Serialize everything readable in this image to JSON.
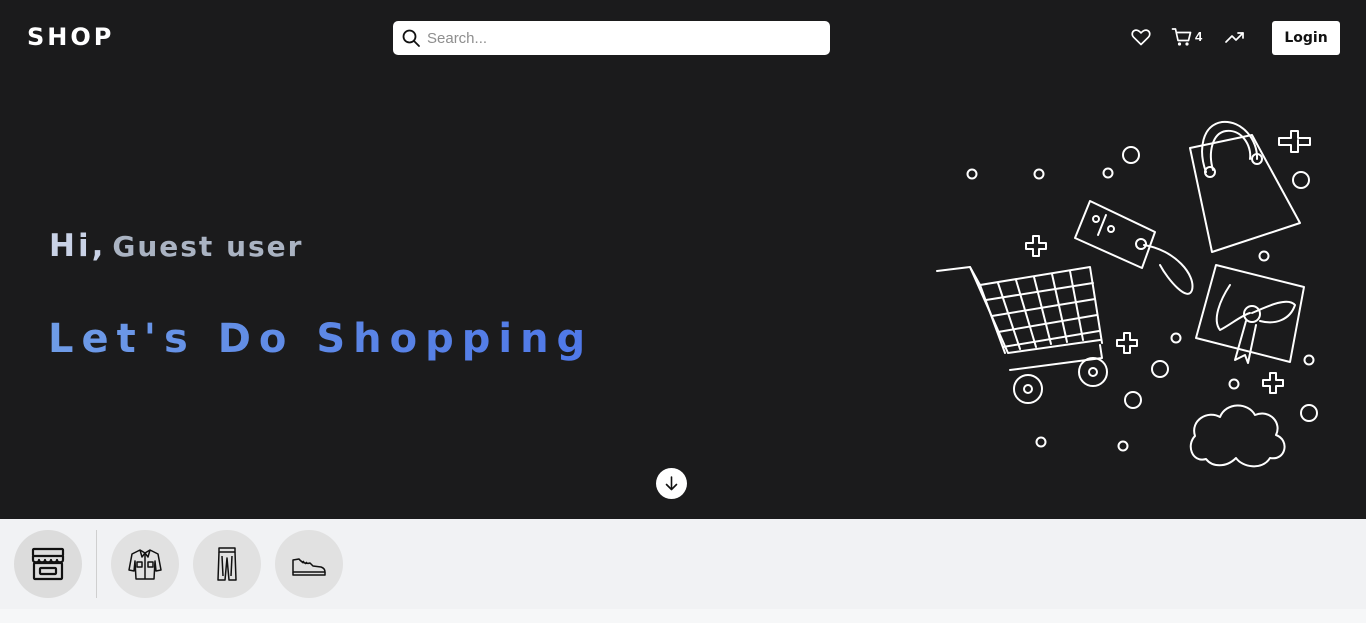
{
  "brand": {
    "logo_text": "SHOP"
  },
  "search": {
    "placeholder": "Search...",
    "value": ""
  },
  "header": {
    "icons": [
      "heart-icon",
      "cart-icon",
      "trending-icon"
    ],
    "cart_count": "4",
    "login_label": "Login"
  },
  "hero": {
    "greeting_hi": "Hi,",
    "greeting_name": "Guest user",
    "tagline": "Let's Do Shopping"
  },
  "categories": {
    "items": [
      "store-icon",
      "shirt-icon",
      "pants-icon",
      "shoe-icon"
    ]
  },
  "colors": {
    "hero_background": "#1b1b1c",
    "tagline_blue": "#5a84e6",
    "category_bar": "#f1f2f4"
  }
}
